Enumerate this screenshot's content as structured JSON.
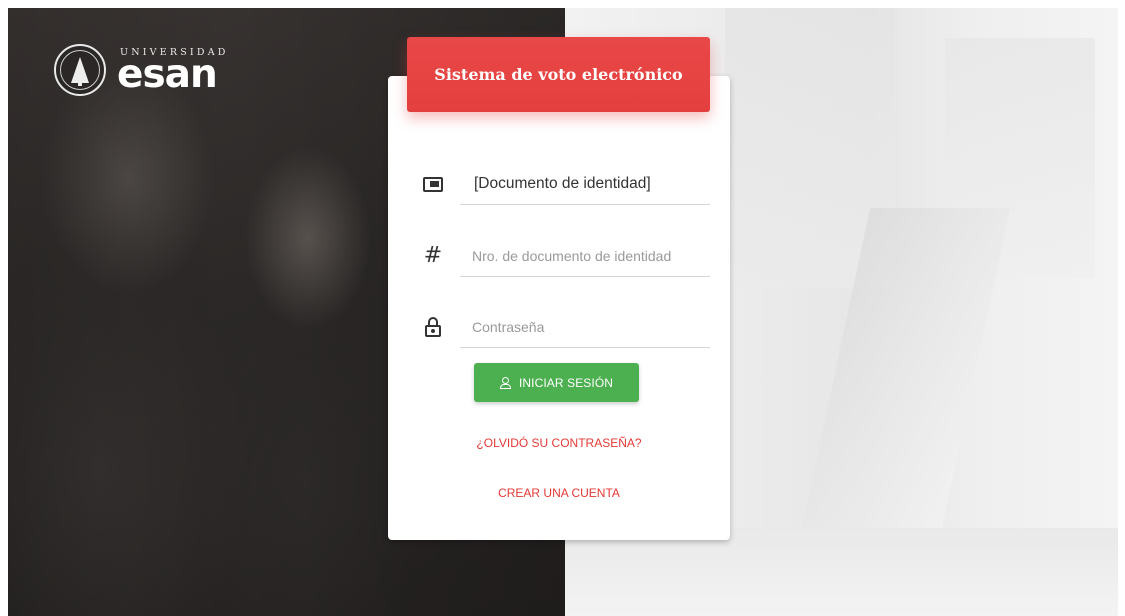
{
  "logo": {
    "small_text": "UNIVERSIDAD",
    "big_text": "esan"
  },
  "card": {
    "title": "Sistema de voto electrónico"
  },
  "fields": {
    "document_type": {
      "value": "[Documento de identidad]",
      "icon": "id-card-icon"
    },
    "document_number": {
      "placeholder": "Nro. de documento de identidad",
      "value": "",
      "icon": "hash-icon"
    },
    "password": {
      "placeholder": "Contraseña",
      "value": "",
      "icon": "lock-icon"
    }
  },
  "actions": {
    "login_label": "INICIAR SESIÓN",
    "forgot_label": "¿OLVIDÓ SU CONTRASEÑA?",
    "create_label": "CREAR UNA CUENTA"
  },
  "colors": {
    "header_red": "#e43f3f",
    "login_green": "#4caf50",
    "link_red": "#e53935"
  }
}
